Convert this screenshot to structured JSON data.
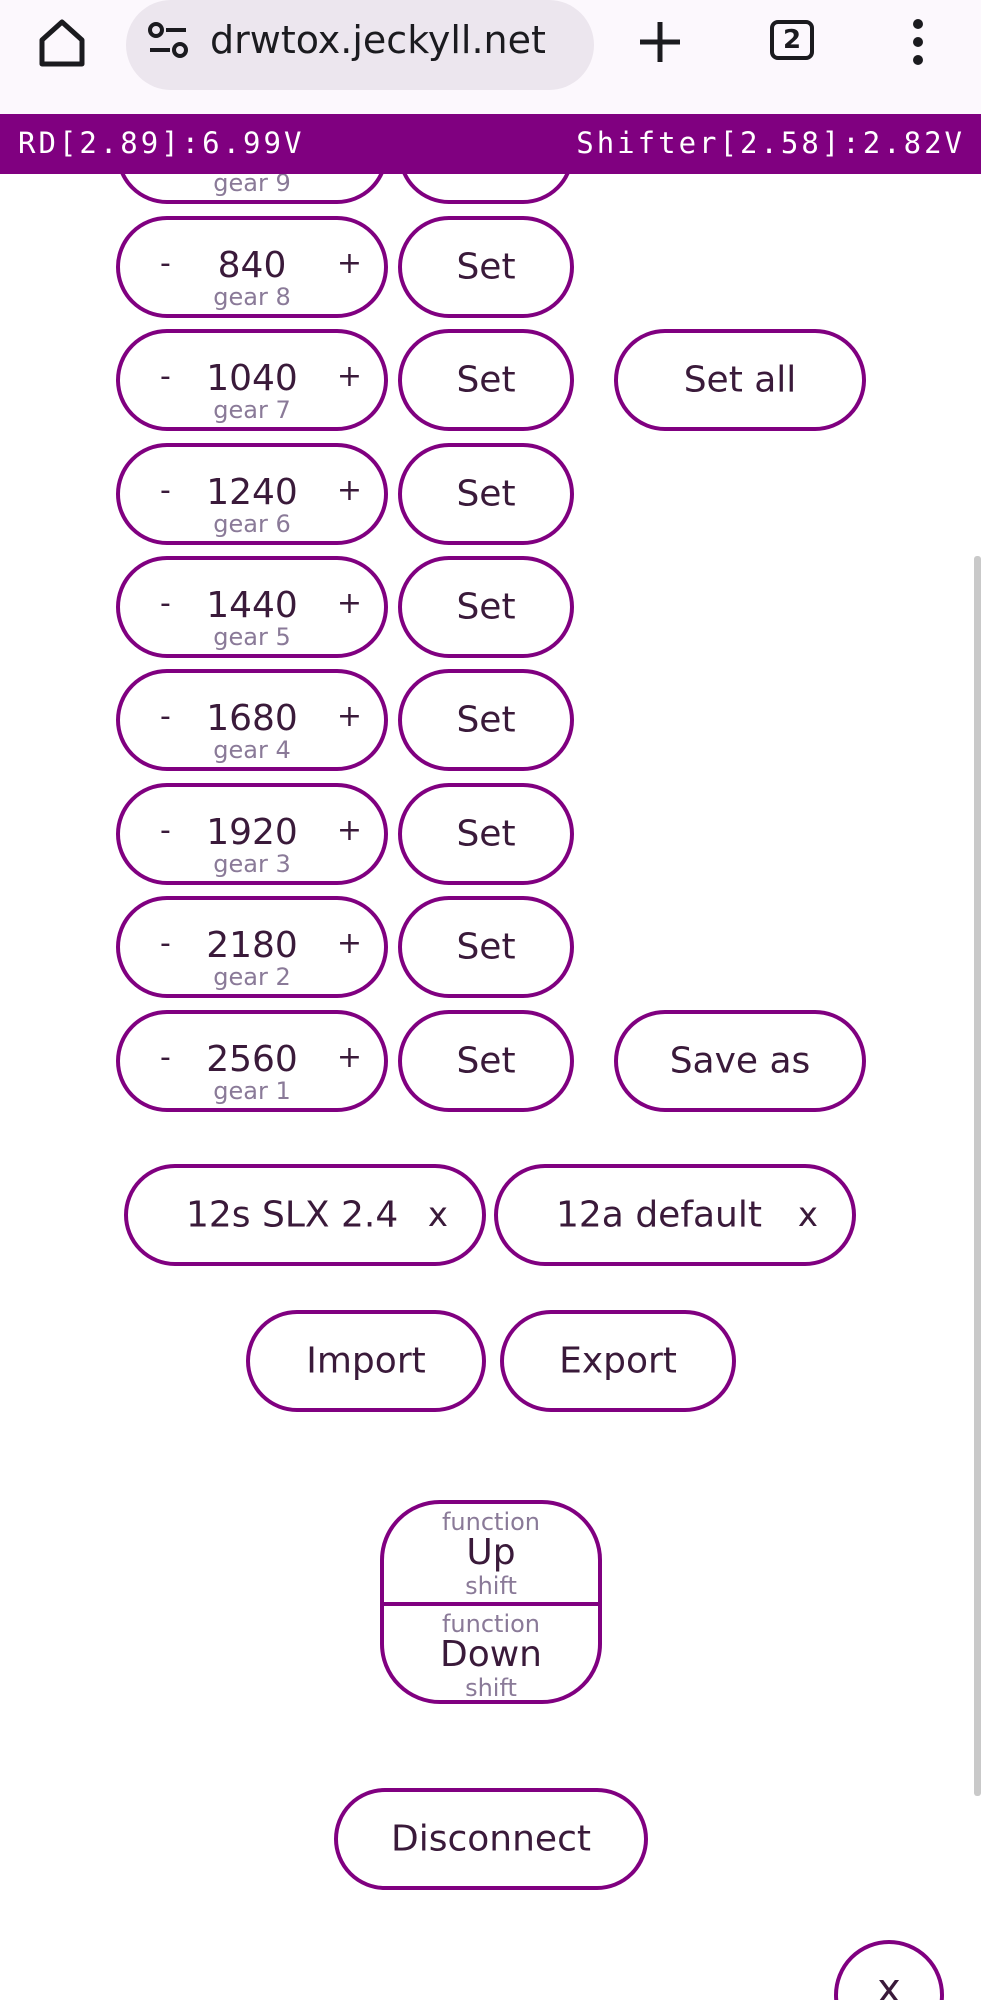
{
  "browser": {
    "url": "drwtox.jeckyll.net",
    "tab_count": "2"
  },
  "status": {
    "left": "RD[2.89]:6.99V",
    "right": "Shifter[2.58]:2.82V"
  },
  "controls": {
    "minus": "-",
    "plus": "+",
    "set": "Set"
  },
  "gears": [
    {
      "value": "840",
      "label": "gear 8"
    },
    {
      "value": "1040",
      "label": "gear 7"
    },
    {
      "value": "1240",
      "label": "gear 6"
    },
    {
      "value": "1440",
      "label": "gear 5"
    },
    {
      "value": "1680",
      "label": "gear 4"
    },
    {
      "value": "1920",
      "label": "gear 3"
    },
    {
      "value": "2180",
      "label": "gear 2"
    },
    {
      "value": "2560",
      "label": "gear 1"
    }
  ],
  "partial_gear": {
    "label": "gear 9"
  },
  "actions": {
    "set_all": "Set all",
    "save_as": "Save as",
    "import": "Import",
    "export": "Export",
    "disconnect": "Disconnect"
  },
  "presets": [
    {
      "name": "12s SLX 2.4",
      "remove": "x"
    },
    {
      "name": "12a default",
      "remove": "x"
    }
  ],
  "shift": {
    "up": {
      "function": "function",
      "label": "Up",
      "sub": "shift"
    },
    "down": {
      "function": "function",
      "label": "Down",
      "sub": "shift"
    }
  },
  "close": {
    "label": "x"
  }
}
